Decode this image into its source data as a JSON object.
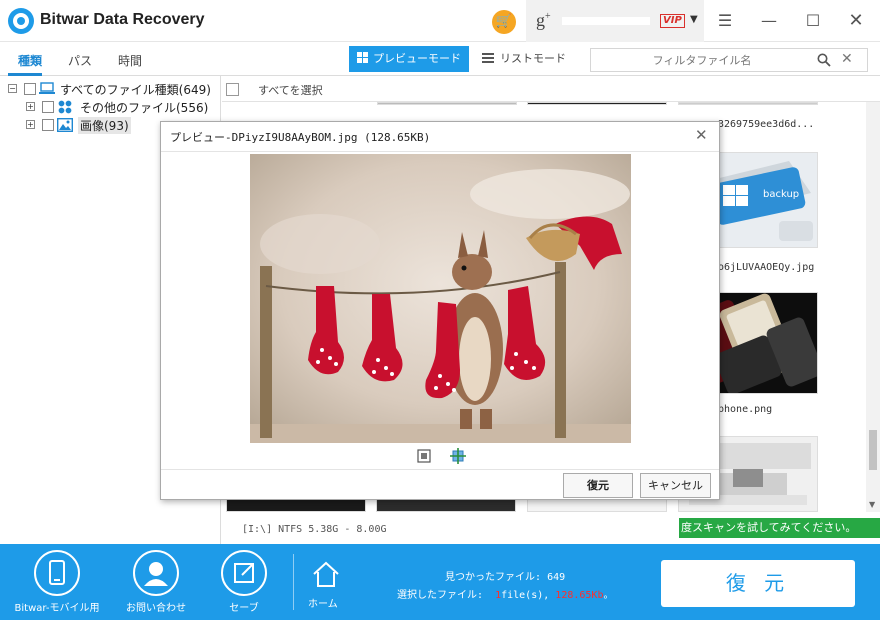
{
  "app": {
    "title": "Bitwar Data Recovery"
  },
  "account": {
    "vip_badge": "VIP"
  },
  "tabs": [
    {
      "label": "種類",
      "active": true
    },
    {
      "label": "パス",
      "active": false
    },
    {
      "label": "時間",
      "active": false
    }
  ],
  "view_modes": {
    "preview": "プレビューモード",
    "list": "リストモード"
  },
  "search": {
    "placeholder": "フィルタファイル名",
    "value": ""
  },
  "tree": {
    "items": [
      {
        "label": "すべてのファイル種類(649)",
        "icon": "computer-icon",
        "expander": "−"
      },
      {
        "label": "その他のファイル(556)",
        "icon": "apps-icon",
        "expander": "+"
      },
      {
        "label": "画像(93)",
        "icon": "image-icon",
        "expander": "+",
        "selected": true
      }
    ]
  },
  "content": {
    "select_all": "すべてを選択",
    "visible_filenames": [
      "3269759ee3d6d...",
      "o6jLUVAAOEQy.jpg",
      "phone.png"
    ]
  },
  "preview_dialog": {
    "title": "プレビュー-DPiyzI9U8AAyBOM.jpg (128.65KB)",
    "recover_button": "復元",
    "cancel_button": "キャンセル"
  },
  "status": {
    "drive": "[I:\\] NTFS 5.38G - 8.00G",
    "promo": "度スキャンを試してみてください。"
  },
  "bottom": {
    "mobile": "Bitwar-モバイル用",
    "contact": "お問い合わせ",
    "save": "セーブ",
    "home": "ホーム",
    "found_label": "見つかったファイル:",
    "found_count": "649",
    "selected_label": "選択したファイル:",
    "selected_count": "1",
    "selected_files_word": "file(s),",
    "selected_size": "128.65Kb",
    "selected_suffix": "。",
    "recover": "復 元"
  },
  "colors": {
    "accent": "#1e9be8",
    "vip_red": "#d9302c",
    "promo_green": "#27a844",
    "selected_red": "#ff2d2d",
    "cart_orange": "#f5a623"
  }
}
